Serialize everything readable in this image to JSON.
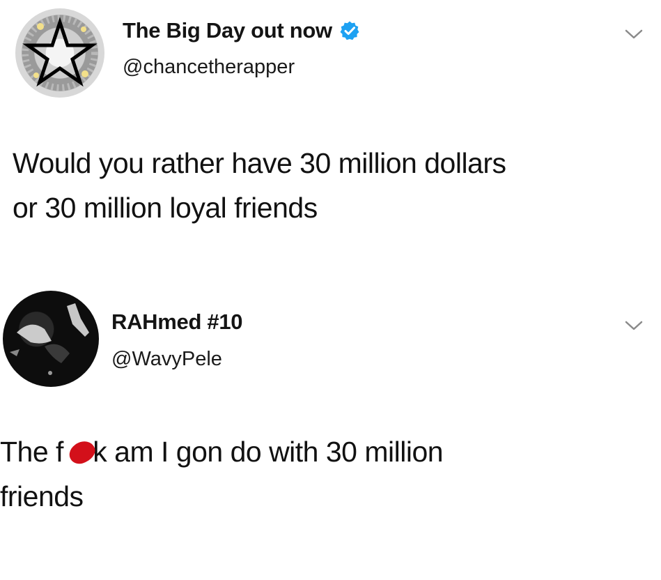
{
  "tweets": [
    {
      "display_name": "The Big Day out now",
      "handle": "@chancetherapper",
      "verified": true,
      "text_line1": "Would you rather have 30 million dollars",
      "text_line2": "or 30 million loyal friends",
      "avatar_icon": "star-icon",
      "menu_icon": "chevron-down-icon"
    },
    {
      "display_name": "RAHmed #10",
      "handle": "@WavyPele",
      "verified": false,
      "text_before": "The f",
      "text_censored_tail": "k",
      "text_after": " am I gon do with 30 million",
      "text_line2": "friends",
      "censor_color": "#d3101a",
      "menu_icon": "chevron-down-icon"
    }
  ],
  "colors": {
    "verified_badge": "#1da1f2",
    "text": "#111111",
    "chevron": "#8a8a8a"
  }
}
